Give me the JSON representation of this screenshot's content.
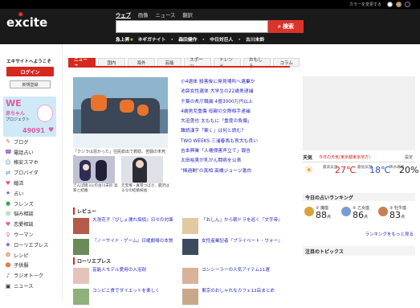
{
  "topbar": {
    "color_label": "カラーを変更する"
  },
  "header": {
    "logo": "excite",
    "search_tabs": [
      "ウェブ",
      "画像",
      "ニュース",
      "翻訳"
    ],
    "search_value": "",
    "search_button": "検索",
    "trend_label": "急上昇",
    "trends": [
      "ネギガナイト",
      "森田健作",
      "中日対巨人",
      "古川未鈴"
    ]
  },
  "sidebar": {
    "welcome": "エキサイトへようこそ",
    "login": "ログイン",
    "signup": "新規登録",
    "banner": {
      "line1": "WE",
      "line2": "赤ちゃん",
      "line3": "プロジェクト",
      "count": "49091"
    },
    "items": [
      {
        "icon": "✎",
        "label": "ブログ",
        "color": "#e0662d"
      },
      {
        "icon": "☎",
        "label": "電話占い",
        "color": "#8a4fbf"
      },
      {
        "icon": "☺",
        "label": "格安スマホ",
        "color": "#3b8bd0"
      },
      {
        "icon": "⇄",
        "label": "プロバイダ",
        "color": "#3b8bd0"
      },
      {
        "icon": "♥",
        "label": "婚活",
        "color": "#e05a9c"
      },
      {
        "icon": "★",
        "label": "占い",
        "color": "#7a58c5"
      },
      {
        "icon": "●",
        "label": "フレンズ",
        "color": "#3aa65a"
      },
      {
        "icon": "✉",
        "label": "悩み相談",
        "color": "#3aa65a"
      },
      {
        "icon": "♥",
        "label": "恋愛相談",
        "color": "#e05a9c"
      },
      {
        "icon": "♀",
        "label": "ウーマン",
        "color": "#e05a9c"
      },
      {
        "icon": "◆",
        "label": "ローリエプレス",
        "color": "#9a6bcf"
      },
      {
        "icon": "✿",
        "label": "レシピ",
        "color": "#e0662d"
      },
      {
        "icon": "☻",
        "label": "子供服",
        "color": "#e0662d"
      },
      {
        "icon": "♪",
        "label": "ラジオトーク",
        "color": "#d5281f"
      },
      {
        "icon": "▣",
        "label": "ニュース",
        "color": "#333333"
      }
    ]
  },
  "tabs": [
    "ニュース",
    "国内",
    "海外",
    "芸能",
    "スポーツ",
    "トレンド",
    "おもしろ",
    "コラム"
  ],
  "main": {
    "photo_caption": "「クジラは恩かった」住民総出で救助、苦闘の末死ね",
    "sub_captions": [
      "でんぱ組.incの古川未鈴 高家と結婚",
      "元宝塚・真琴つばさ、鹿沢はるなの結婚祝福"
    ],
    "headlines": [
      "小4遺体 殺害後に発見場所へ遺棄か",
      "池袋女性遺体 大学生の22歳男逮捕",
      "千葉の県庁職員 4億3000万円以上",
      "4歳男児重傷 母親の交際相手逮捕",
      "大迫勇也 太ももに「重度の負傷」",
      "難読漢字「案く」は何と読む?",
      "TWO WEEKS 三浦春馬も貫大も良い",
      "吉本興業「人権侵害声立て」報告",
      "太田裕美が乳がん闘病を公表",
      "\"稀過剰\"の真相 高橋ジョージ激白"
    ]
  },
  "review": {
    "head": "レビュー",
    "items": [
      "大渕花子『ぴしょ濡れ探偵』日々の対面",
      "「おしん」から朝ドラを巡く『文字帝』",
      "『ノーサイド・ゲーム』日曜劇場の本質",
      "女性産業記者『プライベート・ウォー』"
    ],
    "head2": "ローリエプレス",
    "items2": [
      "芸能人モデル愛用の入浴剤",
      "コンシーラーの人気アイテム11選",
      "コンビニ食でダイエットを楽しく",
      "東京のおしゃれなカフェ12店まとめ"
    ]
  },
  "weather": {
    "title": "天気",
    "location": "今日の天気(東京都東京地方)",
    "setting": "設定",
    "max_label": "最高気温",
    "max_val": "27℃",
    "min_label": "最低気温",
    "min_val": "18℃",
    "rain_label": "降水確率",
    "rain_val": "20%"
  },
  "fortune": {
    "title": "今日の占いランキング",
    "items": [
      {
        "rank": "① 魔座",
        "score": "88",
        "unit": "点",
        "color": "#d9a23a"
      },
      {
        "rank": "② 乙女座",
        "score": "86",
        "unit": "点",
        "color": "#7a9cd4"
      },
      {
        "rank": "③ 牡牛座",
        "score": "83",
        "unit": "点",
        "color": "#c9804a"
      }
    ],
    "more": "ランキングをもっと見る"
  },
  "topics": {
    "title": "注目のトピックス"
  }
}
